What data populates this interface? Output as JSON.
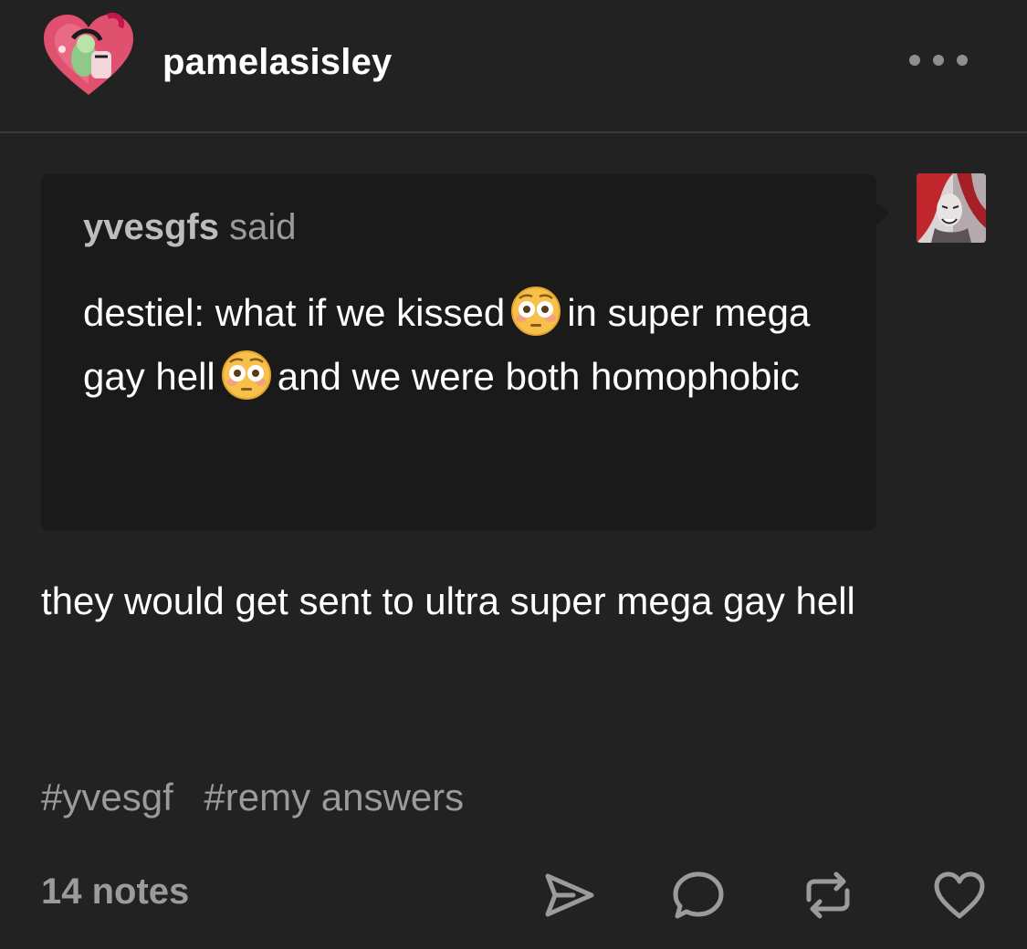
{
  "post": {
    "author": "pamelasisley",
    "more_icon": "ellipsis-icon",
    "quote": {
      "author": "yvesgfs",
      "said_label": "said",
      "body_part1": "destiel: what if we kissed",
      "body_part2": "in super mega gay hell",
      "body_part3": "and we were both homophobic",
      "emoji": "flushed-face"
    },
    "reply": "they would get sent to ultra super mega gay hell",
    "tags": [
      "#yvesgf",
      "#remy answers"
    ],
    "notes_label": "14 notes",
    "actions": [
      "share-icon",
      "reply-icon",
      "reblog-icon",
      "like-icon"
    ]
  },
  "colors": {
    "background": "#222222",
    "quote_background": "#1a1a1a",
    "muted_text": "#9b9b9b",
    "accent_heart": "#e0506f"
  }
}
